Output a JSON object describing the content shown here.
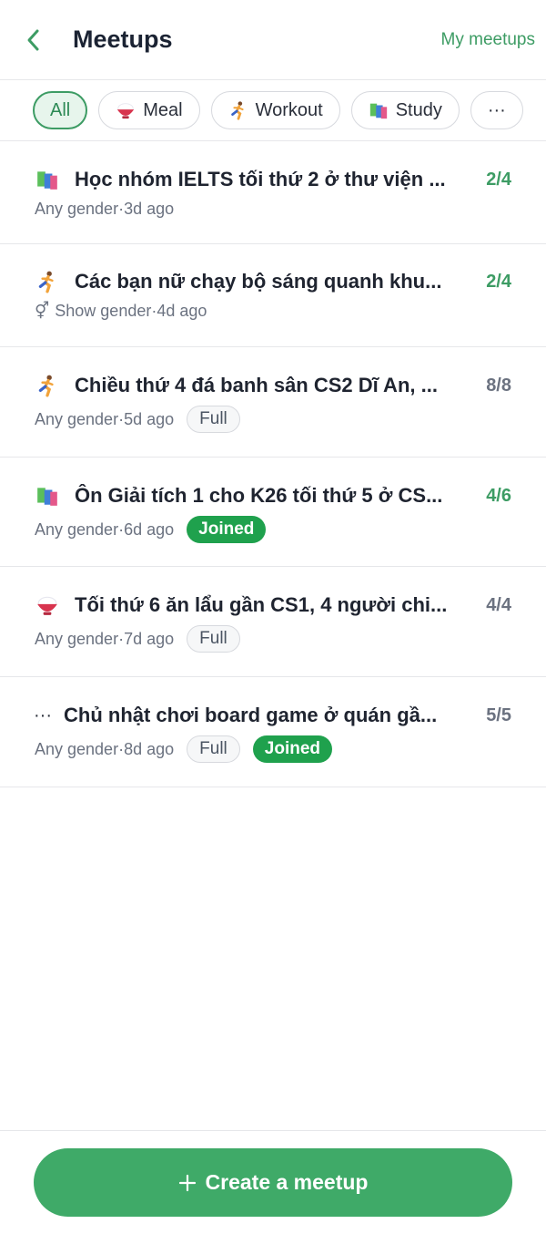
{
  "header": {
    "title": "Meetups",
    "my_meetups": "My meetups"
  },
  "filters": [
    {
      "label": "All",
      "icon": "none"
    },
    {
      "label": "Meal",
      "icon": "rice-bowl-icon"
    },
    {
      "label": "Workout",
      "icon": "running-icon"
    },
    {
      "label": "Study",
      "icon": "books-icon"
    },
    {
      "label": "···",
      "icon": "more-icon"
    }
  ],
  "meetups": [
    {
      "icon": "books-icon",
      "title": "Học nhóm IELTS tối thứ 2 ở thư viện ...",
      "count": "2/4",
      "gender": "Any gender",
      "time": "3d ago",
      "full": "",
      "joined": ""
    },
    {
      "icon": "running-icon",
      "title": "Các bạn nữ chạy bộ sáng quanh khu...",
      "count": "2/4",
      "gender": "Show gender",
      "time": "4d ago",
      "full": "",
      "joined": ""
    },
    {
      "icon": "running-icon",
      "title": "Chiều thứ 4 đá banh sân CS2 Dĩ An, ...",
      "count": "8/8",
      "gender": "Any gender",
      "time": "5d ago",
      "full": "Full",
      "joined": ""
    },
    {
      "icon": "books-icon",
      "title": "Ôn Giải tích 1 cho K26 tối thứ 5 ở CS...",
      "count": "4/6",
      "gender": "Any gender",
      "time": "6d ago",
      "full": "",
      "joined": "Joined"
    },
    {
      "icon": "rice-bowl-icon",
      "title": "Tối thứ 6 ăn lẩu gần CS1, 4 người chi...",
      "count": "4/4",
      "gender": "Any gender",
      "time": "7d ago",
      "full": "Full",
      "joined": ""
    },
    {
      "icon": "more-icon",
      "title": "Chủ nhật chơi board game ở quán gầ...",
      "count": "5/5",
      "gender": "Any gender",
      "time": "8d ago",
      "full": "Full",
      "joined": "Joined"
    }
  ],
  "separator": " · ",
  "create_button": "Create a meetup",
  "colors": {
    "accent": "#3d9c64",
    "joined": "#1fa14d",
    "button": "#3faa68"
  }
}
